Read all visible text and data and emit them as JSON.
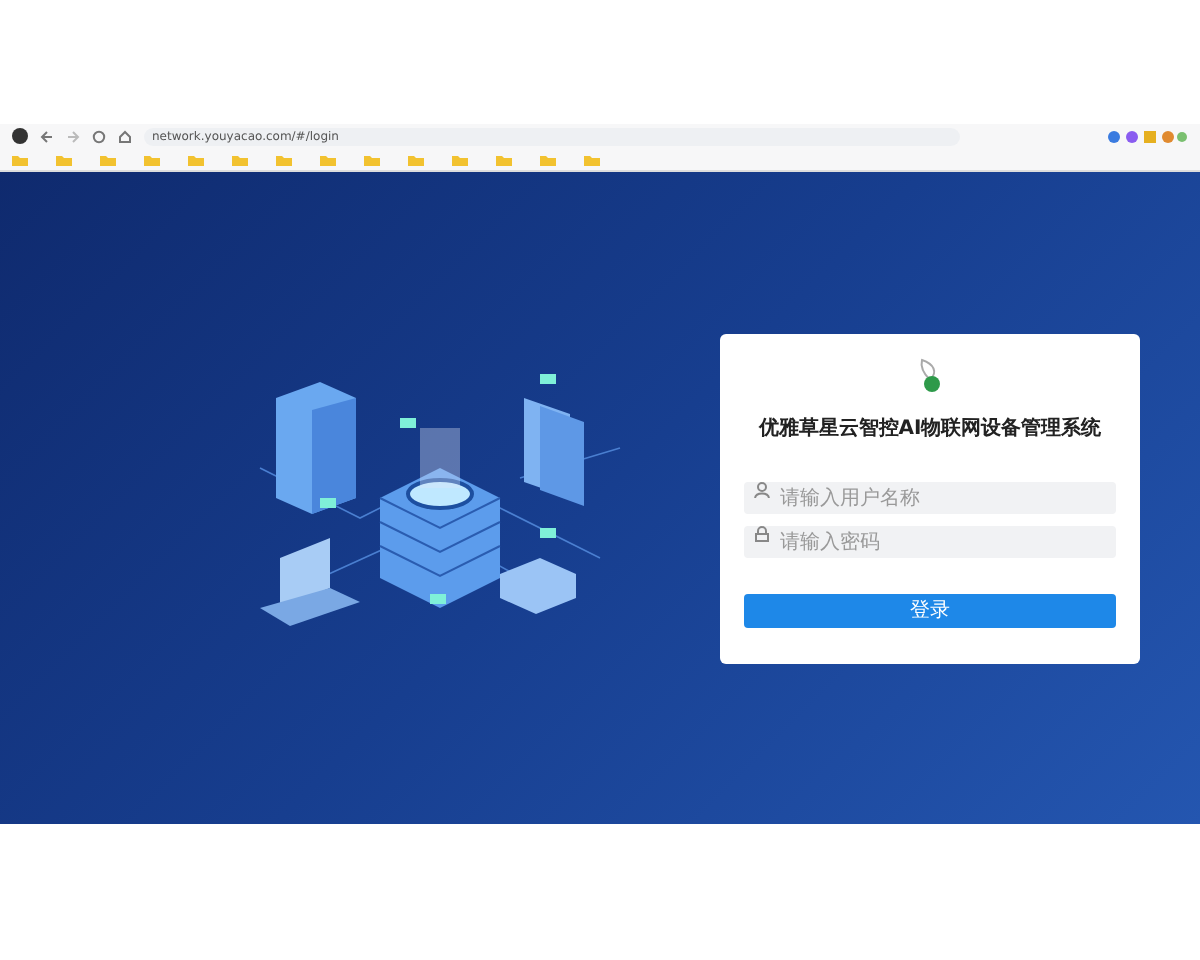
{
  "browser": {
    "url": "network.youyacao.com/#/login"
  },
  "login": {
    "title": "优雅草星云智控AI物联网设备管理系统",
    "fields": [
      {
        "kind": "user",
        "placeholder": "请输入用户名称"
      },
      {
        "kind": "lock",
        "placeholder": "请输入密码"
      }
    ],
    "button": "登录"
  }
}
